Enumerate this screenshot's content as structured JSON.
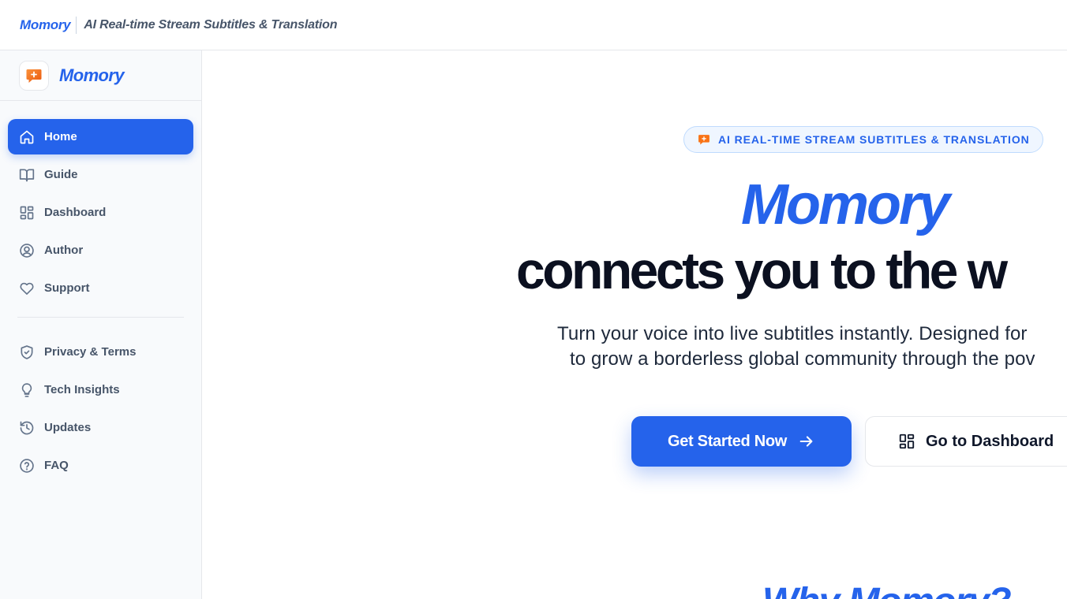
{
  "topbar": {
    "brand": "Momory",
    "tagline": "AI Real-time Stream Subtitles & Translation"
  },
  "sidebar": {
    "brand": "Momory",
    "primary_items": [
      {
        "label": "Home",
        "icon": "home-icon",
        "active": true
      },
      {
        "label": "Guide",
        "icon": "book-icon"
      },
      {
        "label": "Dashboard",
        "icon": "dashboard-icon"
      },
      {
        "label": "Author",
        "icon": "user-circle-icon"
      },
      {
        "label": "Support",
        "icon": "heart-icon"
      }
    ],
    "secondary_items": [
      {
        "label": "Privacy & Terms",
        "icon": "shield-check-icon"
      },
      {
        "label": "Tech Insights",
        "icon": "lightbulb-icon"
      },
      {
        "label": "Updates",
        "icon": "history-icon"
      },
      {
        "label": "FAQ",
        "icon": "help-circle-icon"
      }
    ]
  },
  "hero": {
    "badge": "AI REAL-TIME STREAM SUBTITLES & TRANSLATION",
    "brand": "Momory",
    "headline": "connects you to the w",
    "subtitle_line1": "Turn your voice into live subtitles instantly. Designed for",
    "subtitle_line2": "to grow a borderless global community through the pov",
    "primary_cta": "Get Started Now",
    "secondary_cta": "Go to Dashboard"
  },
  "section": {
    "why_title": "Why Momory?"
  },
  "colors": {
    "accent": "#2563eb",
    "logo_orange": "#f97316",
    "text_dark": "#0b1020",
    "sidebar_bg": "#f8fafc"
  }
}
